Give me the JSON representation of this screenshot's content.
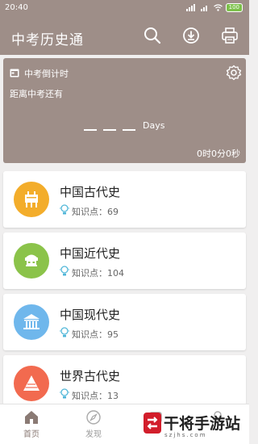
{
  "status": {
    "time": "20:40",
    "battery": "100"
  },
  "appbar": {
    "title": "中考历史通"
  },
  "countdown": {
    "heading": "中考倒计时",
    "subtitle": "距离中考还有",
    "days_label": "Days",
    "remaining": "0时0分0秒"
  },
  "subjects": [
    {
      "name": "中国古代史",
      "points": "知识点：69",
      "color": "#f3ad2b"
    },
    {
      "name": "中国近代史",
      "points": "知识点：104",
      "color": "#8bc34a"
    },
    {
      "name": "中国现代史",
      "points": "知识点：95",
      "color": "#6fb7ec"
    },
    {
      "name": "世界古代史",
      "points": "知识点：13",
      "color": "#f26a4f"
    }
  ],
  "tabs": [
    {
      "label": "首页"
    },
    {
      "label": "发现"
    }
  ],
  "watermark": {
    "text": "干将手游站",
    "url": "szjhs.com"
  }
}
